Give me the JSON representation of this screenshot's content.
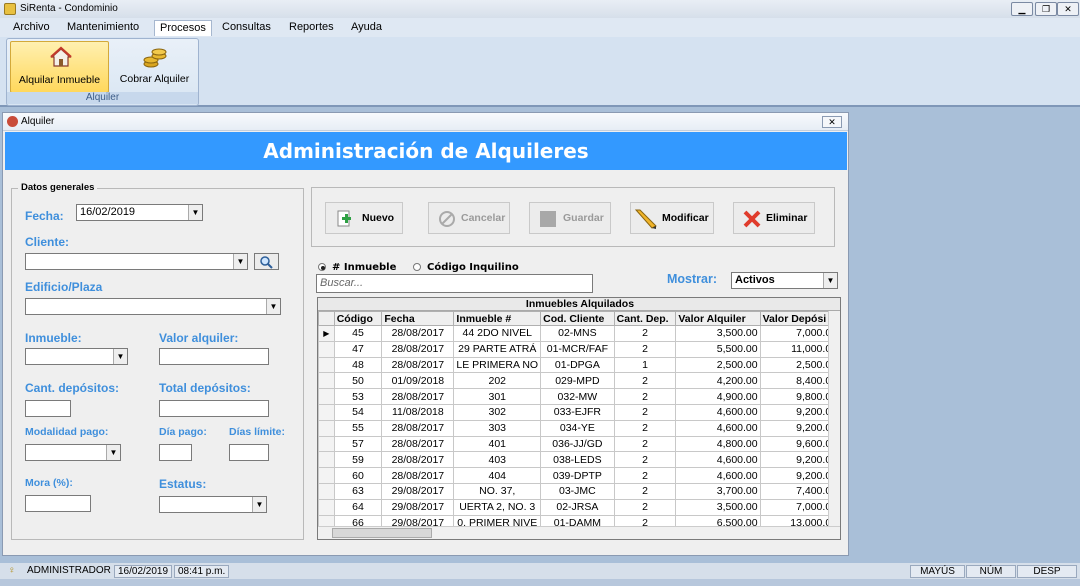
{
  "window": {
    "title": "SiRenta - Condominio"
  },
  "menu": [
    "Archivo",
    "Mantenimiento",
    "Procesos",
    "Consultas",
    "Reportes",
    "Ayuda"
  ],
  "ribbon": {
    "group_label": "Alquiler",
    "btn1": "Alquilar Inmueble",
    "btn2": "Cobrar Alquiler"
  },
  "child": {
    "title": "Alquiler",
    "heading": "Administración de Alquileres"
  },
  "form": {
    "legend": "Datos generales",
    "fecha_label": "Fecha:",
    "fecha_value": "16/02/2019",
    "cliente_label": "Cliente:",
    "edificio_label": "Edificio/Plaza",
    "inmueble_label": "Inmueble:",
    "valor_label": "Valor alquiler:",
    "cant_dep_label": "Cant. depósitos:",
    "total_dep_label": "Total depósitos:",
    "modalidad_label": "Modalidad pago:",
    "dia_pago_label": "Día pago:",
    "dias_limite_label": "Días límite:",
    "mora_label": "Mora (%):",
    "estatus_label": "Estatus:"
  },
  "toolbar": {
    "nuevo": "Nuevo",
    "cancelar": "Cancelar",
    "guardar": "Guardar",
    "modificar": "Modificar",
    "eliminar": "Eliminar"
  },
  "filters": {
    "radio1": "# Inmueble",
    "radio2": "Código Inquilino",
    "search_placeholder": "Buscar...",
    "mostrar_label": "Mostrar:",
    "mostrar_value": "Activos"
  },
  "grid": {
    "caption": "Inmuebles Alquilados",
    "columns": [
      "Código",
      "Fecha",
      "Inmueble #",
      "Cod. Cliente",
      "Cant. Dep.",
      "Valor Alquiler",
      "Valor Depósi"
    ],
    "rows": [
      [
        "45",
        "28/08/2017",
        "44 2DO NIVEL",
        "02-MNS",
        "2",
        "3,500.00",
        "7,000.00"
      ],
      [
        "47",
        "28/08/2017",
        "29 PARTE ATRÁ",
        "01-MCR/FAF",
        "2",
        "5,500.00",
        "11,000.00"
      ],
      [
        "48",
        "28/08/2017",
        "LE PRIMERA NO",
        "01-DPGA",
        "1",
        "2,500.00",
        "2,500.00"
      ],
      [
        "50",
        "01/09/2018",
        "202",
        "029-MPD",
        "2",
        "4,200.00",
        "8,400.00"
      ],
      [
        "53",
        "28/08/2017",
        "301",
        "032-MW",
        "2",
        "4,900.00",
        "9,800.00"
      ],
      [
        "54",
        "11/08/2018",
        "302",
        "033-EJFR",
        "2",
        "4,600.00",
        "9,200.00"
      ],
      [
        "55",
        "28/08/2017",
        "303",
        "034-YE",
        "2",
        "4,600.00",
        "9,200.00"
      ],
      [
        "57",
        "28/08/2017",
        "401",
        "036-JJ/GD",
        "2",
        "4,800.00",
        "9,600.00"
      ],
      [
        "59",
        "28/08/2017",
        "403",
        "038-LEDS",
        "2",
        "4,600.00",
        "9,200.00"
      ],
      [
        "60",
        "28/08/2017",
        "404",
        "039-DPTP",
        "2",
        "4,600.00",
        "9,200.00"
      ],
      [
        "63",
        "29/08/2017",
        "NO. 37,",
        "03-JMC",
        "2",
        "3,700.00",
        "7,400.00"
      ],
      [
        "64",
        "29/08/2017",
        "UERTA 2, NO. 3",
        "02-JRSA",
        "2",
        "3,500.00",
        "7,000.00"
      ],
      [
        "66",
        "29/08/2017",
        "0. PRIMER NIVE",
        "01-DAMM",
        "2",
        "6,500.00",
        "13,000.00"
      ]
    ]
  },
  "status": {
    "user": "ADMINISTRADOR",
    "date": "16/02/2019",
    "time": "08:41 p.m.",
    "mayus": "MAYÚS",
    "num": "NÚM",
    "desp": "DESP"
  }
}
